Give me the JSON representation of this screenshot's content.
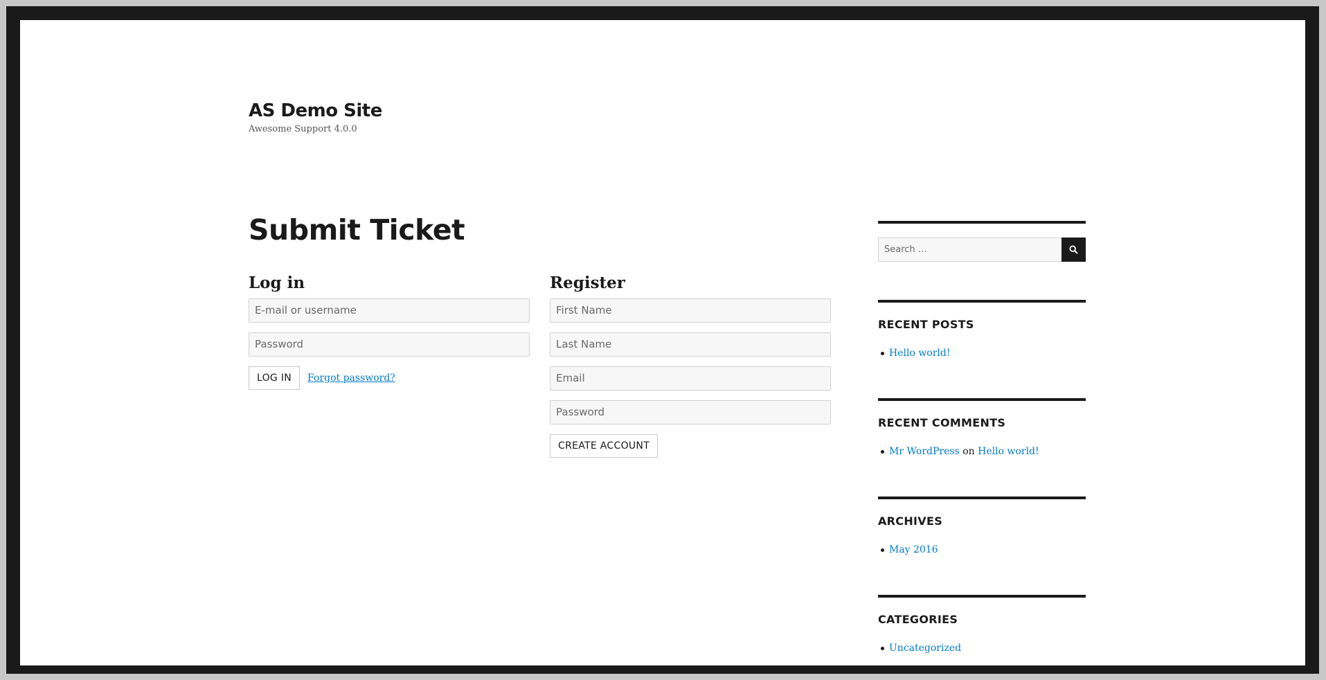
{
  "site": {
    "title": "AS Demo Site",
    "description": "Awesome Support 4.0.0"
  },
  "page": {
    "title": "Submit Ticket"
  },
  "login": {
    "heading": "Log in",
    "username_placeholder": "E-mail or username",
    "password_placeholder": "Password",
    "submit_label": "LOG IN",
    "forgot_label": "Forgot password?"
  },
  "register": {
    "heading": "Register",
    "first_name_placeholder": "First Name",
    "last_name_placeholder": "Last Name",
    "email_placeholder": "Email",
    "password_placeholder": "Password",
    "submit_label": "CREATE ACCOUNT"
  },
  "sidebar": {
    "search": {
      "placeholder": "Search …",
      "icon": "search-icon"
    },
    "recent_posts": {
      "title": "RECENT POSTS",
      "items": [
        "Hello world!"
      ]
    },
    "recent_comments": {
      "title": "RECENT COMMENTS",
      "items": [
        {
          "author": "Mr WordPress",
          "on": "on",
          "post": "Hello world!"
        }
      ]
    },
    "archives": {
      "title": "ARCHIVES",
      "items": [
        "May 2016"
      ]
    },
    "categories": {
      "title": "CATEGORIES",
      "items": [
        "Uncategorized"
      ]
    }
  },
  "colors": {
    "link": "#007acc",
    "text": "#1a1a1a",
    "frame": "#1a1a1a"
  }
}
